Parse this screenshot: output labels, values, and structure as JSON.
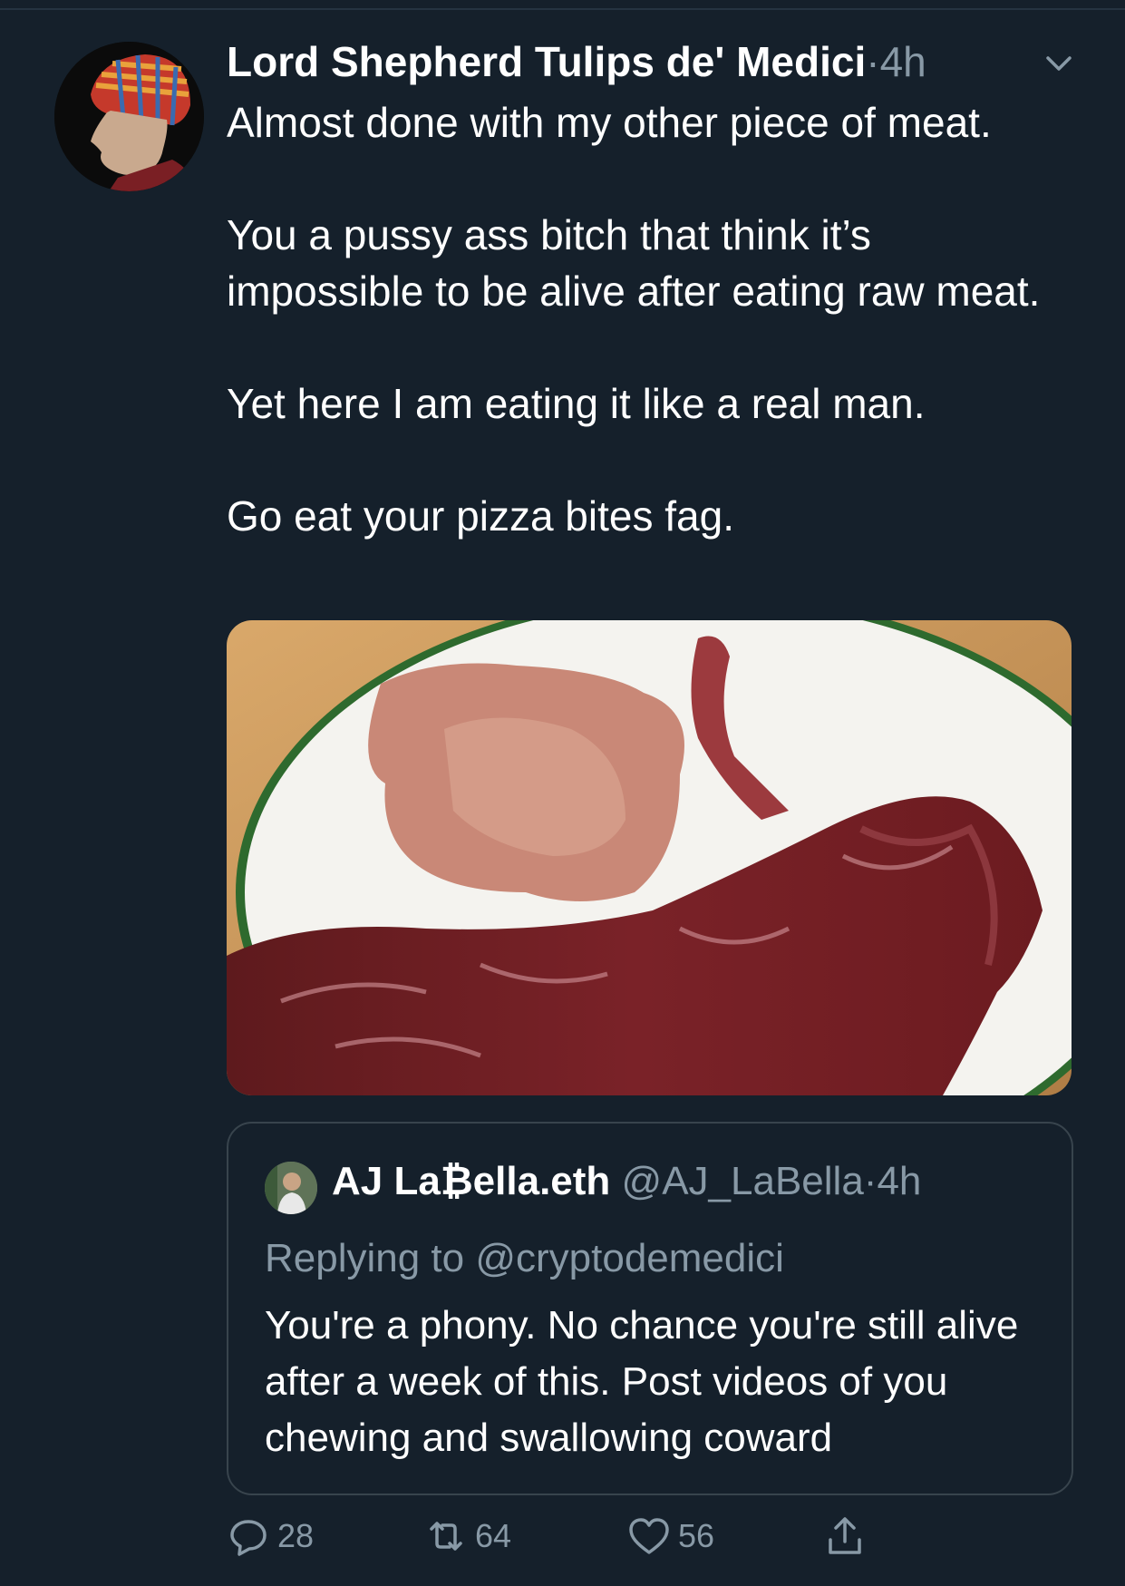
{
  "tweet": {
    "author_name": "Lord Shepherd Tulips de' Medici",
    "separator": "·",
    "time": "4h",
    "text": "Almost done with my other piece of meat.\n\nYou a pussy ass bitch that think it’s impossible to be alive after eating raw meat.\n\nYet here I am eating it like a real man.\n\nGo eat your pizza bites fag."
  },
  "quoted": {
    "author_name": "AJ La₿ella.eth",
    "handle": "@AJ_LaBella",
    "separator": "·",
    "time": "4h",
    "replying_to": "Replying to @cryptodemedici",
    "text": "You're a phony. No chance you're still alive after a week of this. Post videos of you chewing and swallowing coward"
  },
  "actions": {
    "replies": "28",
    "retweets": "64",
    "likes": "56"
  },
  "icons": [
    "chevron-down-icon",
    "reply-icon",
    "retweet-icon",
    "like-icon",
    "share-icon"
  ],
  "colors": {
    "background": "#15202b",
    "secondary_text": "#8899a6",
    "border": "#38444d"
  }
}
